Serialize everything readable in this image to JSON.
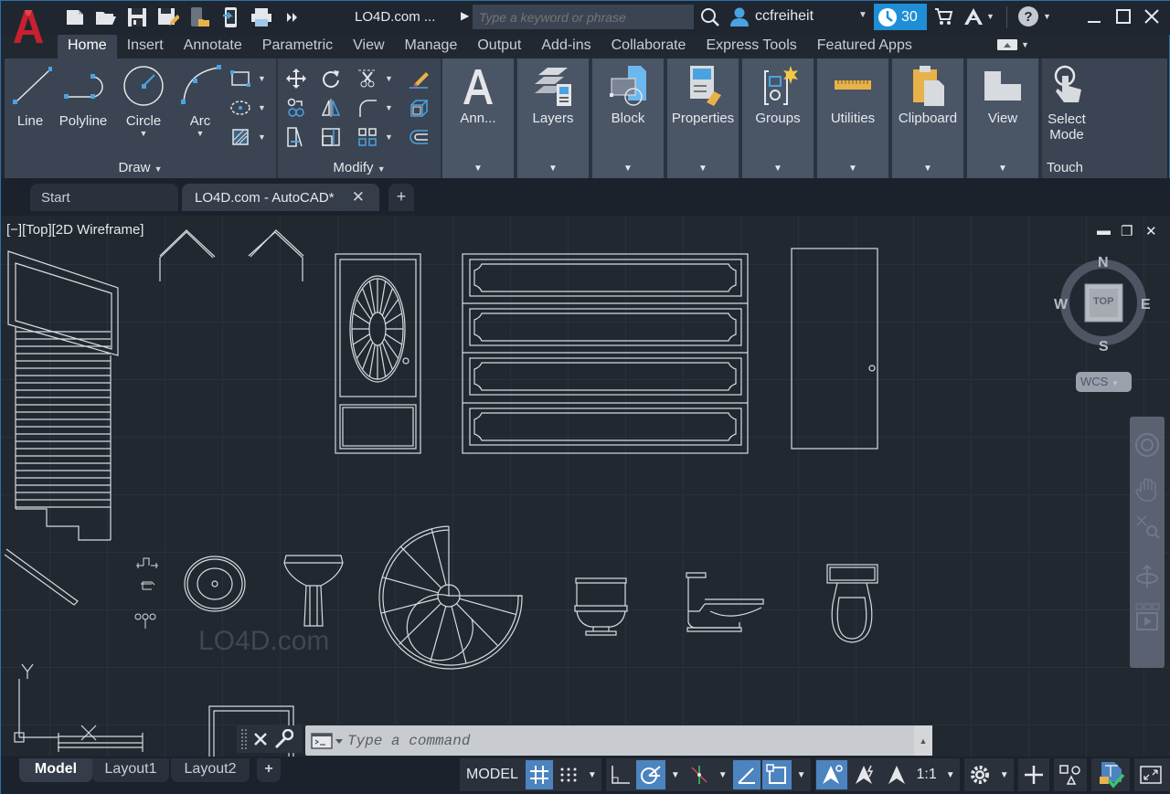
{
  "app": {
    "document_title": "LO4D.com ...",
    "brand_color": "#c8202f",
    "accent_color": "#1e8fd6"
  },
  "quick_access": {
    "items": [
      "new-icon",
      "open-icon",
      "save-icon",
      "save-as-icon",
      "open-from-mobile-icon",
      "save-to-mobile-icon",
      "plot-icon",
      "more-icon"
    ]
  },
  "search": {
    "placeholder": "Type a keyword or phrase"
  },
  "user": {
    "name": "ccfreiheit",
    "trial_days": "30"
  },
  "ribbon_tabs": [
    "Home",
    "Insert",
    "Annotate",
    "Parametric",
    "View",
    "Manage",
    "Output",
    "Add-ins",
    "Collaborate",
    "Express Tools",
    "Featured Apps"
  ],
  "ribbon": {
    "draw": {
      "title": "Draw",
      "tools": [
        "Line",
        "Polyline",
        "Circle",
        "Arc"
      ]
    },
    "modify": {
      "title": "Modify"
    },
    "groups": [
      {
        "label": "Ann...",
        "icon": "annotation-icon"
      },
      {
        "label": "Layers",
        "icon": "layers-icon"
      },
      {
        "label": "Block",
        "icon": "block-icon"
      },
      {
        "label": "Properties",
        "icon": "properties-icon"
      },
      {
        "label": "Groups",
        "icon": "groups-icon"
      },
      {
        "label": "Utilities",
        "icon": "ruler-icon"
      },
      {
        "label": "Clipboard",
        "icon": "clipboard-icon"
      },
      {
        "label": "View",
        "icon": "view-icon"
      }
    ],
    "touch": {
      "tool_line1": "Select",
      "tool_line2": "Mode",
      "title": "Touch"
    }
  },
  "file_tabs": [
    {
      "label": "Start"
    },
    {
      "label": "LO4D.com - AutoCAD*"
    }
  ],
  "viewport": {
    "label": "[−][Top][2D Wireframe]",
    "viewcube": {
      "top": "TOP",
      "n": "N",
      "s": "S",
      "e": "E",
      "w": "W"
    },
    "ucs": "WCS",
    "axis_x": "X",
    "axis_y": "Y",
    "watermark": "LO4D.com"
  },
  "command_line": {
    "placeholder": "Type a command"
  },
  "layout_tabs": [
    "Model",
    "Layout1",
    "Layout2"
  ],
  "status_bar": {
    "model_label": "MODEL",
    "scale": "1:1"
  }
}
